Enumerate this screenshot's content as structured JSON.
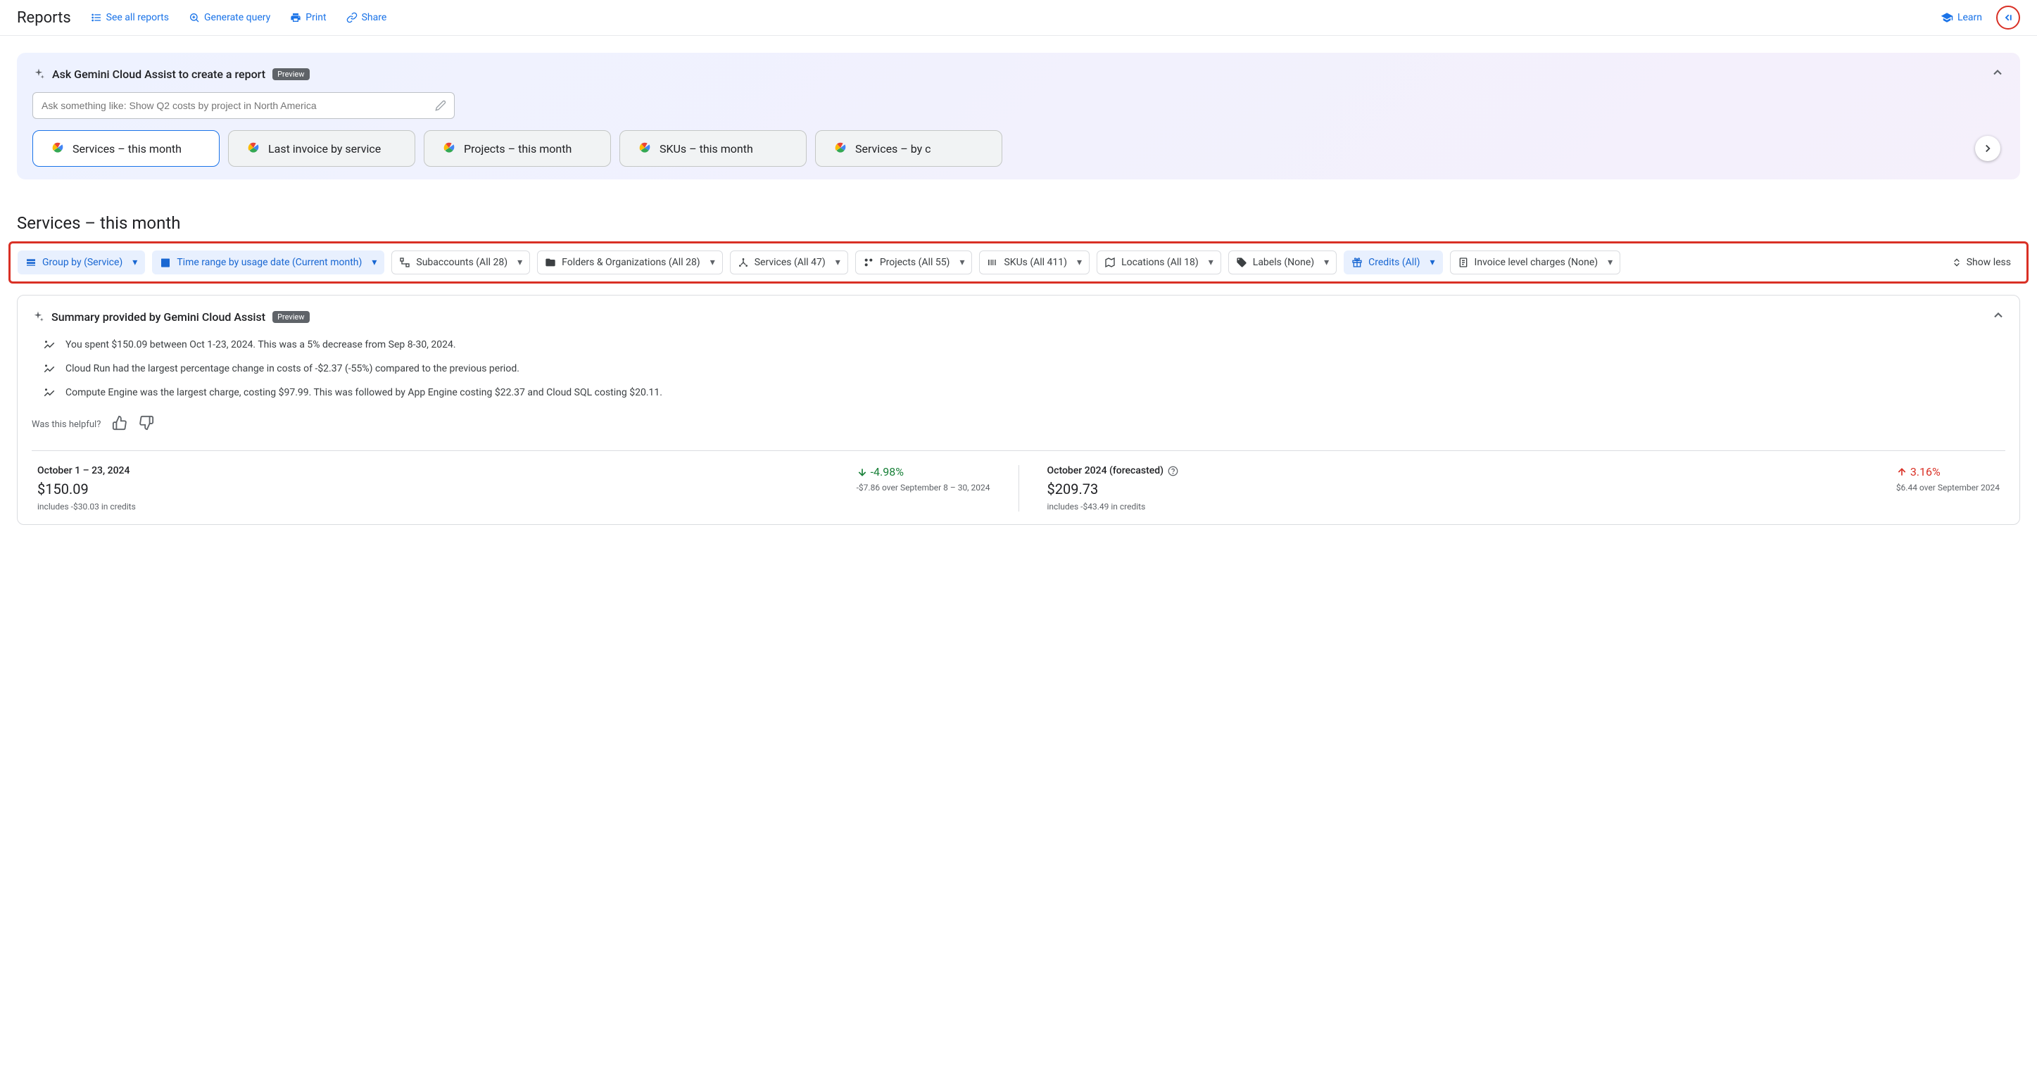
{
  "topbar": {
    "title": "Reports",
    "links": {
      "see_all": "See all reports",
      "generate": "Generate query",
      "print": "Print",
      "share": "Share",
      "learn": "Learn"
    }
  },
  "gemini": {
    "title": "Ask Gemini Cloud Assist to create a report",
    "preview_label": "Preview",
    "placeholder": "Ask something like: Show Q2 costs by project in North America",
    "suggestions": [
      "Services – this month",
      "Last invoice by service",
      "Projects – this month",
      "SKUs – this month",
      "Services – by c"
    ]
  },
  "section": {
    "title": "Services – this month"
  },
  "filters": {
    "group_by": "Group by (Service)",
    "time_range": "Time range by usage date (Current month)",
    "subaccounts": "Subaccounts (All 28)",
    "folders": "Folders & Organizations (All 28)",
    "services": "Services (All 47)",
    "projects": "Projects (All 55)",
    "skus": "SKUs (All 411)",
    "locations": "Locations (All 18)",
    "labels": "Labels (None)",
    "credits": "Credits (All)",
    "invoice": "Invoice level charges (None)",
    "show_less": "Show less"
  },
  "summary": {
    "title": "Summary provided by Gemini Cloud Assist",
    "preview_label": "Preview",
    "insights": [
      "You spent $150.09 between Oct 1-23, 2024. This was a 5% decrease from Sep 8-30, 2024.",
      "Cloud Run had the largest percentage change in costs of -$2.37 (-55%) compared to the previous period.",
      "Compute Engine was the largest charge, costing $97.99. This was followed by App Engine costing $22.37 and Cloud SQL costing $20.11."
    ],
    "helpful": "Was this helpful?"
  },
  "stats": {
    "actual": {
      "period": "October 1 – 23, 2024",
      "amount": "$150.09",
      "credits": "includes -$30.03 in credits",
      "change": "-4.98%",
      "change_sub": "-$7.86 over September 8 – 30, 2024"
    },
    "forecast": {
      "period": "October 2024 (forecasted)",
      "amount": "$209.73",
      "credits": "includes -$43.49 in credits",
      "change": "3.16%",
      "change_sub": "$6.44 over September 2024"
    }
  }
}
